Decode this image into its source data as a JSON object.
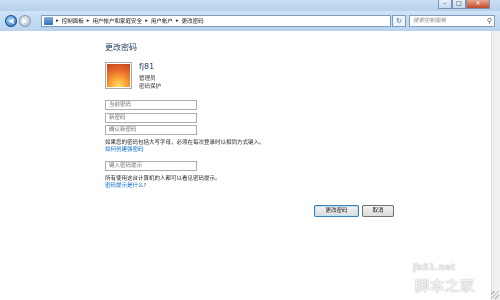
{
  "window": {
    "caption_minimize": "–",
    "caption_maximize": "□",
    "caption_close": "✕"
  },
  "nav": {
    "back_icon": "◀",
    "forward_icon": "▶",
    "breadcrumbs": [
      "控制面板",
      "用户帐户和家庭安全",
      "用户帐户",
      "更改密码"
    ],
    "separator": "▸",
    "refresh_icon": "↻",
    "search_placeholder": "搜索控制面板",
    "search_icon": "⚲"
  },
  "main": {
    "title": "更改密码",
    "user": {
      "name": "fj81",
      "role": "管理员",
      "protection": "密码保护"
    },
    "fields": {
      "current_password": "当前密码",
      "new_password": "新密码",
      "confirm_password": "确认新密码",
      "hint": "键入密码提示"
    },
    "caps_notice": "如果您的密码包括大写字母，必须在每次登录时以相同方式键入。",
    "strong_password_link": "如何创建强密码",
    "hint_notice": "所有使用这台计算机的人都可以看见密码提示。",
    "hint_link": "密码提示是什么?",
    "buttons": {
      "change": "更改密码",
      "cancel": "取消"
    }
  },
  "watermark": {
    "site": "jb51.net",
    "brand": "脚本之家"
  }
}
